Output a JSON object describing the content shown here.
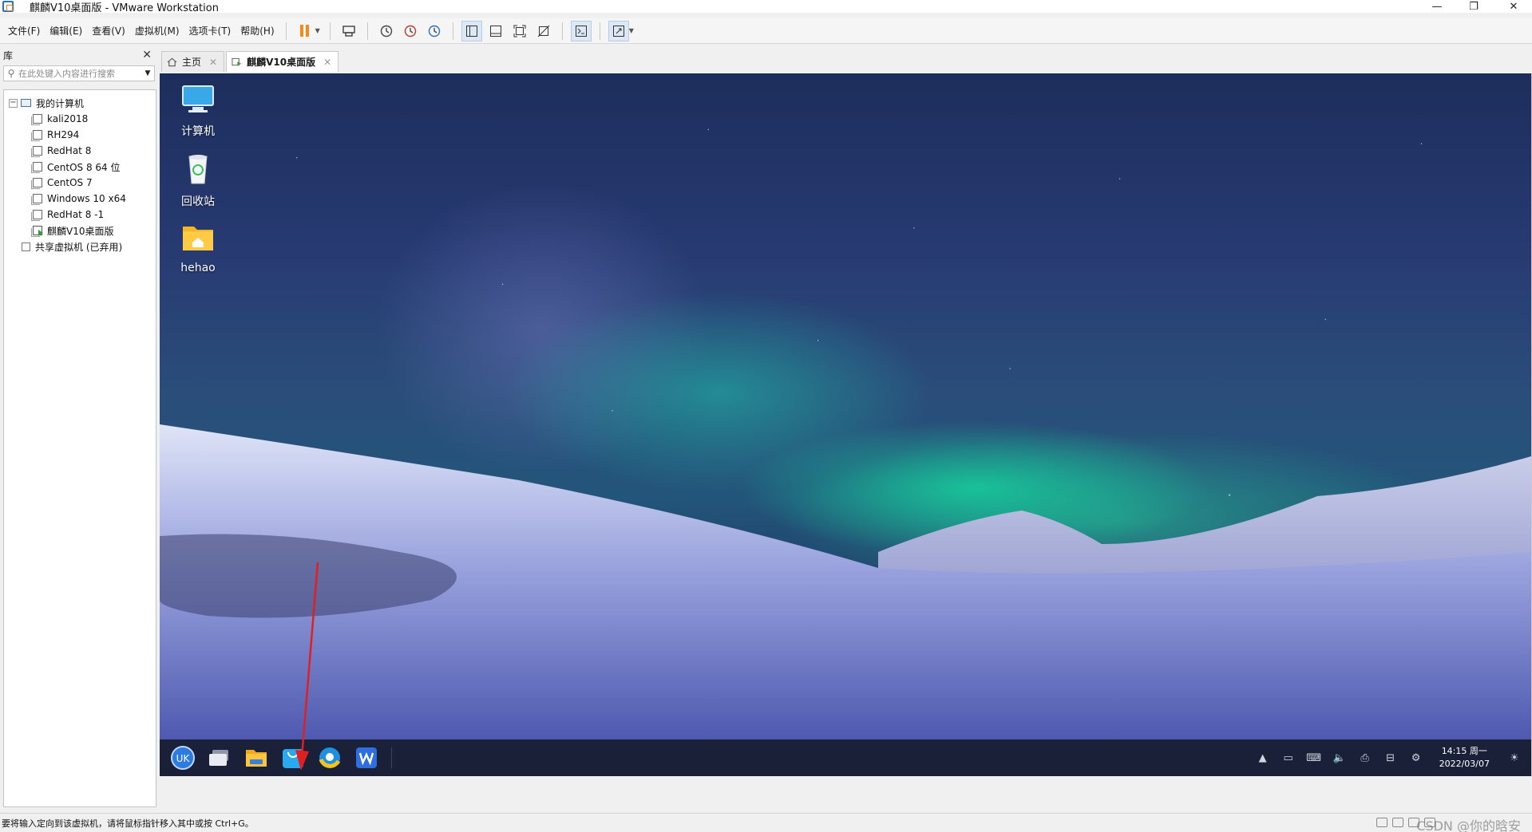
{
  "window": {
    "title": "麒麟V10桌面版 - VMware Workstation",
    "minimize": "—",
    "restore": "❐",
    "close": "✕"
  },
  "menu": [
    "文件(F)",
    "编辑(E)",
    "查看(V)",
    "虚拟机(M)",
    "选项卡(T)",
    "帮助(H)"
  ],
  "library": {
    "title": "库",
    "close": "✕",
    "search_placeholder": "在此处键入内容进行搜索",
    "tree_root": "我的计算机",
    "vms": [
      "kali2018",
      "RH294",
      "RedHat 8",
      "CentOS 8 64 位",
      "CentOS 7",
      "Windows 10 x64",
      "RedHat 8 -1",
      "麒麟V10桌面版"
    ],
    "shared": "共享虚拟机 (已弃用)"
  },
  "tabs": [
    {
      "label": "主页",
      "close": "✕"
    },
    {
      "label": "麒麟V10桌面版",
      "close": "✕"
    }
  ],
  "desktop": {
    "icons": [
      {
        "label": "计算机",
        "icon": "monitor-icon"
      },
      {
        "label": "回收站",
        "icon": "recycle-bin-icon"
      },
      {
        "label": "hehao",
        "icon": "home-folder-icon"
      }
    ],
    "taskbar_apps": [
      "start-menu-icon",
      "multitask-view-icon",
      "file-manager-icon",
      "software-store-icon",
      "browser-icon",
      "wps-writer-icon"
    ],
    "clock_time": "14:15 周一",
    "clock_date": "2022/03/07"
  },
  "statusbar": {
    "message": "要将输入定向到该虚拟机，请将鼠标指针移入其中或按 Ctrl+G。",
    "watermark": "CSDN @你的晗安"
  },
  "colors": {
    "accent_orange": "#f08c1c",
    "vm_running_green": "#2fa02f",
    "taskbar_bg": "#161c2e"
  }
}
